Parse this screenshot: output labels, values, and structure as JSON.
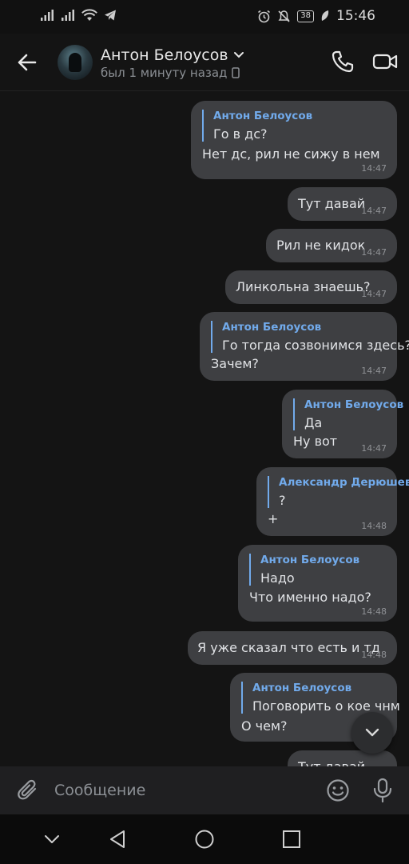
{
  "status_bar": {
    "time": "15:46",
    "battery": "38"
  },
  "header": {
    "contact_name": "Антон Белоусов",
    "last_seen": "был 1 минуту назад"
  },
  "messages": [
    {
      "reply_author": "Антон Белоусов",
      "reply_text": "Го в дс?",
      "text": "Нет дс, рил не сижу в нем",
      "time": "14:47"
    },
    {
      "text": "Тут давай",
      "time": "14:47"
    },
    {
      "text": "Рил не кидок",
      "time": "14:47"
    },
    {
      "text": "Линкольна знаешь?",
      "time": "14:47"
    },
    {
      "reply_author": "Антон Белоусов",
      "reply_text": "Го тогда созвонимся здесь?",
      "text": "Зачем?",
      "time": "14:47"
    },
    {
      "reply_author": "Антон Белоусов",
      "reply_text": "Да",
      "text": "Ну вот",
      "time": "14:47"
    },
    {
      "reply_author": "Александр Дерюшев",
      "reply_text": "?",
      "text": "+",
      "time": "14:48"
    },
    {
      "reply_author": "Антон Белоусов",
      "reply_text": "Надо",
      "text": "Что именно надо?",
      "time": "14:48"
    },
    {
      "text": "Я уже сказал что есть и тд",
      "time": "14:48"
    },
    {
      "reply_author": "Антон Белоусов",
      "reply_text": "Поговорить о кое чнм",
      "text": "О чем?",
      "time": ""
    },
    {
      "text": "Тут давай",
      "time": ""
    }
  ],
  "composer": {
    "placeholder": "Сообщение"
  },
  "colors": {
    "bubble": "#3e3f42",
    "accent": "#71aaeb",
    "background": "#141414"
  },
  "icons": {
    "back": "arrow-left-icon",
    "call": "phone-icon",
    "video": "video-camera-icon",
    "attach": "paperclip-icon",
    "emoji": "smile-icon",
    "mic": "microphone-icon",
    "scroll": "chevron-down-icon"
  }
}
